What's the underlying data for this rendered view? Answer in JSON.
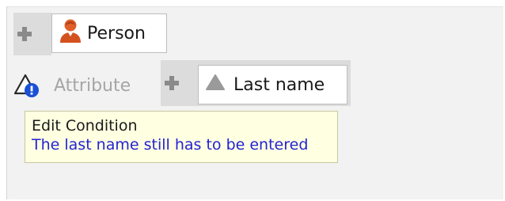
{
  "condition": {
    "subject": {
      "label": "Person",
      "icon": "person-icon"
    },
    "row": {
      "status_icon": "warning-info-icon",
      "attribute_placeholder": "Attribute",
      "attribute_value": {
        "label": "Last name",
        "icon": "triangle-icon"
      }
    },
    "add_icon": "plus-icon"
  },
  "tooltip": {
    "title": "Edit Condition",
    "message": "The last name still has to be entered"
  },
  "colors": {
    "panel_bg": "#f2f2f2",
    "tooltip_bg": "#ffffe1",
    "message_text": "#2323d6",
    "placeholder_text": "#a6a6a6",
    "person_icon": "#e0602a"
  }
}
